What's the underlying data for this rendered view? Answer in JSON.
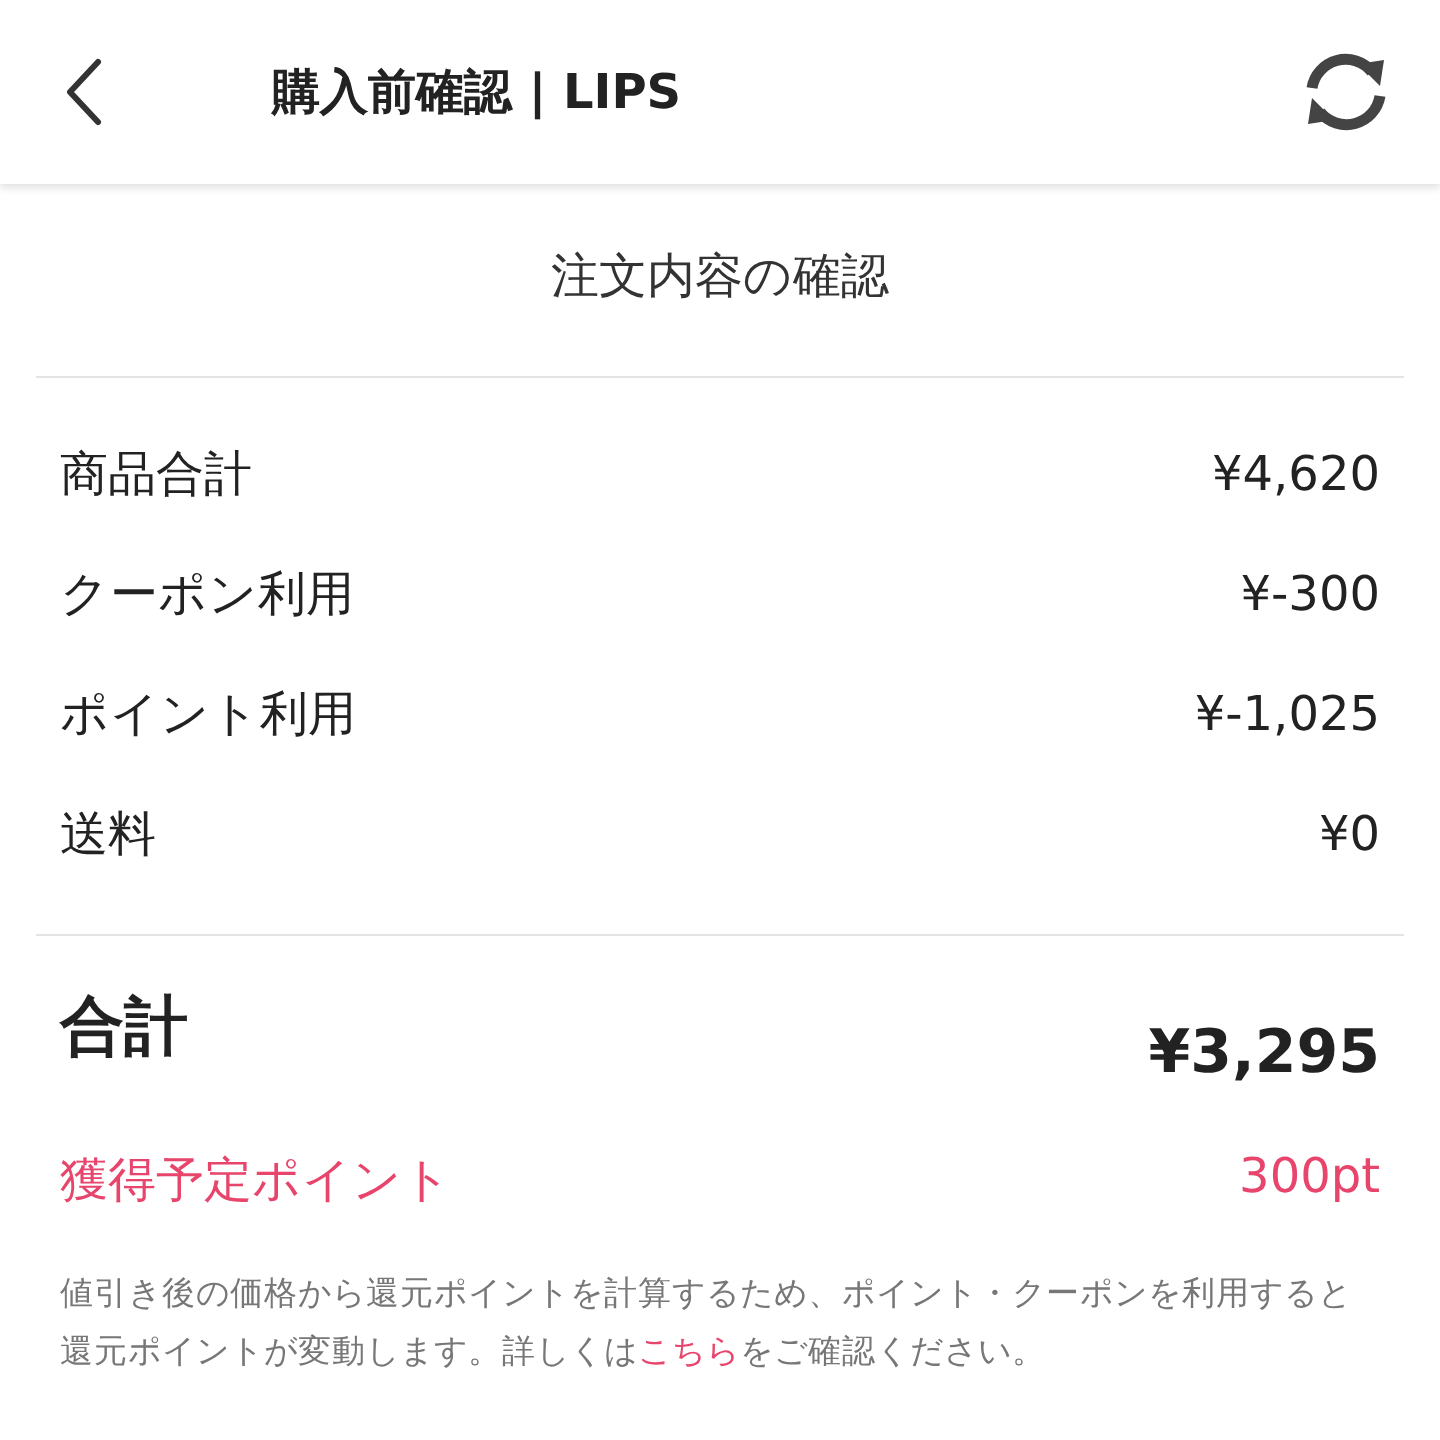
{
  "header": {
    "title": "購入前確認 | LIPS"
  },
  "section_title": "注文内容の確認",
  "lines": [
    {
      "label": "商品合計",
      "value": "¥4,620"
    },
    {
      "label": "クーポン利用",
      "value": "¥-300"
    },
    {
      "label": "ポイント利用",
      "value": "¥-1,025"
    },
    {
      "label": "送料",
      "value": "¥0"
    }
  ],
  "total": {
    "label": "合計",
    "value": "¥3,295"
  },
  "points": {
    "label": "獲得予定ポイント",
    "value": "300pt"
  },
  "note": {
    "before": "値引き後の価格から還元ポイントを計算するため、ポイント・クーポンを利用すると還元ポイントが変動します。詳しくは",
    "link": "こちら",
    "after": "をご確認ください。"
  }
}
